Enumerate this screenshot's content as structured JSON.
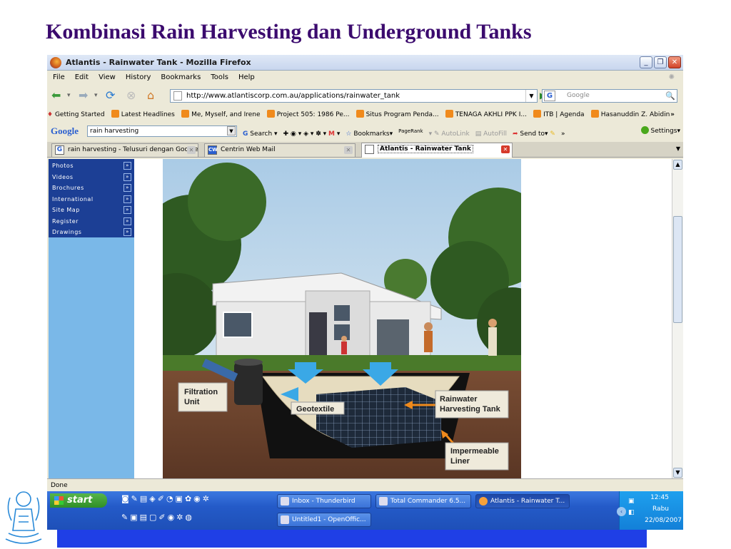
{
  "slide": {
    "title": "Kombinasi Rain Harvesting dan Underground Tanks"
  },
  "window": {
    "title": "Atlantis - Rainwater Tank - Mozilla Firefox"
  },
  "menu": [
    "File",
    "Edit",
    "View",
    "History",
    "Bookmarks",
    "Tools",
    "Help"
  ],
  "nav": {
    "url": "http://www.atlantiscorp.com.au/applications/rainwater_tank",
    "search_placeholder": "Google"
  },
  "bookmarks": [
    "Getting Started",
    "Latest Headlines",
    "Me, Myself, and Irene",
    "Project 505: 1986 Pe...",
    "Situs Program Penda...",
    "TENAGA AKHLI PPK I...",
    "ITB | Agenda",
    "Hasanuddin Z. Abidin",
    "»"
  ],
  "google_toolbar": {
    "logo": "Google",
    "query": "rain harvesting",
    "search_label": "Search",
    "bookmarks_label": "Bookmarks",
    "pagerank_label": "PageRank",
    "autolink_label": "AutoLink",
    "autofill_label": "AutoFill",
    "sendto_label": "Send to",
    "more": "»",
    "settings_label": "Settings"
  },
  "tabs": [
    {
      "label": "rain harvesting - Telusuri dengan Google",
      "icon": "G"
    },
    {
      "label": "Centrin Web Mail",
      "icon": "CW"
    },
    {
      "label": "Atlantis - Rainwater Tank",
      "icon": ""
    }
  ],
  "sidebar": {
    "items": [
      "Photos",
      "Videos",
      "Brochures",
      "International",
      "Site Map",
      "Register",
      "Drawings"
    ],
    "arrow": "»"
  },
  "diagram_labels": {
    "filtration": [
      "Filtration",
      "Unit"
    ],
    "geotextile": "Geotextile",
    "tank": [
      "Rainwater",
      "Harvesting Tank"
    ],
    "liner": [
      "Impermeable",
      "Liner"
    ]
  },
  "status": "Done",
  "taskbar": {
    "start": "start",
    "buttons": [
      "Inbox - Thunderbird",
      "Total Commander 6.5...",
      "Atlantis - Rainwater T...",
      "Untitled1 - OpenOffic..."
    ],
    "clock": {
      "time": "12:45",
      "day": "Rabu",
      "date": "22/08/2007"
    }
  }
}
